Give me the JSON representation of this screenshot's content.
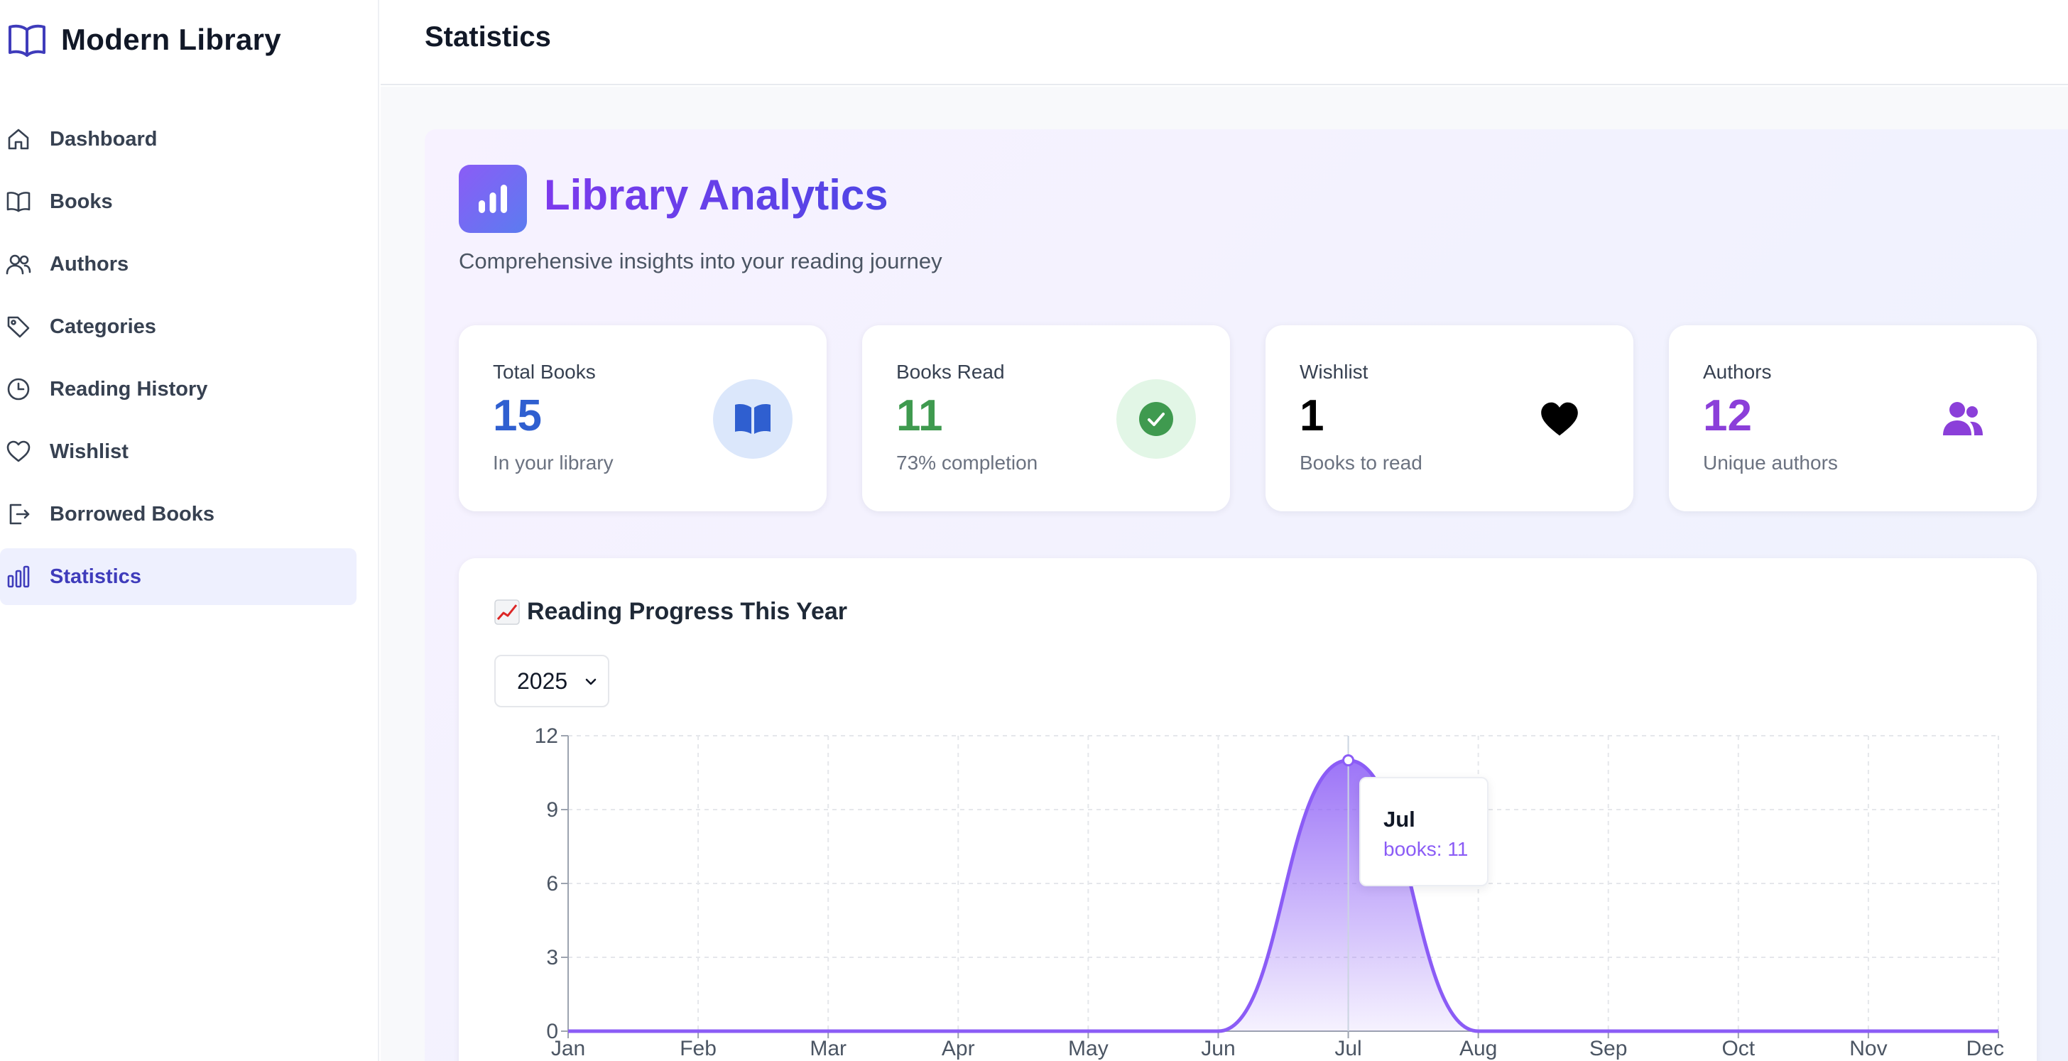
{
  "app": {
    "name": "Modern Library"
  },
  "header": {
    "title": "Statistics"
  },
  "sidebar": {
    "items": [
      {
        "label": "Dashboard",
        "icon": "home-icon"
      },
      {
        "label": "Books",
        "icon": "book-icon"
      },
      {
        "label": "Authors",
        "icon": "users-icon"
      },
      {
        "label": "Categories",
        "icon": "tag-icon"
      },
      {
        "label": "Reading History",
        "icon": "clock-icon"
      },
      {
        "label": "Wishlist",
        "icon": "heart-icon"
      },
      {
        "label": "Borrowed Books",
        "icon": "logout-icon"
      },
      {
        "label": "Statistics",
        "icon": "bar-chart-icon",
        "active": true
      }
    ]
  },
  "hero": {
    "title": "Library Analytics",
    "subtitle": "Comprehensive insights into your reading journey"
  },
  "stats": [
    {
      "label": "Total Books",
      "value": "15",
      "sub": "In your library",
      "icon": "book-open-icon",
      "color": "#2f5fd0",
      "icon_bg": "#dbe7fb"
    },
    {
      "label": "Books Read",
      "value": "11",
      "sub": "73% completion",
      "icon": "check-circle-icon",
      "color": "#3f9a4f",
      "icon_bg": "#e2f6e6"
    },
    {
      "label": "Wishlist",
      "value": "1",
      "sub": "Books to read",
      "icon": "heart-icon",
      "color": "#000000",
      "icon_bg": "#ffffff"
    },
    {
      "label": "Authors",
      "value": "12",
      "sub": "Unique authors",
      "icon": "users-icon",
      "color": "#8b3fd9",
      "icon_bg": "#ffffff"
    }
  ],
  "chart_section": {
    "title": "Reading Progress This Year",
    "year_selected": "2025",
    "tooltip": {
      "month": "Jul",
      "text": "books: 11"
    }
  },
  "chart_data": {
    "type": "area",
    "categories": [
      "Jan",
      "Feb",
      "Mar",
      "Apr",
      "May",
      "Jun",
      "Jul",
      "Aug",
      "Sep",
      "Oct",
      "Nov",
      "Dec"
    ],
    "series": [
      {
        "name": "books",
        "values": [
          0,
          0,
          0,
          0,
          0,
          0,
          11,
          0,
          0,
          0,
          0,
          0
        ]
      }
    ],
    "yticks": [
      0,
      3,
      6,
      9,
      12
    ],
    "ylim": [
      0,
      12
    ],
    "grid": true,
    "color": "#8b5cf6"
  }
}
